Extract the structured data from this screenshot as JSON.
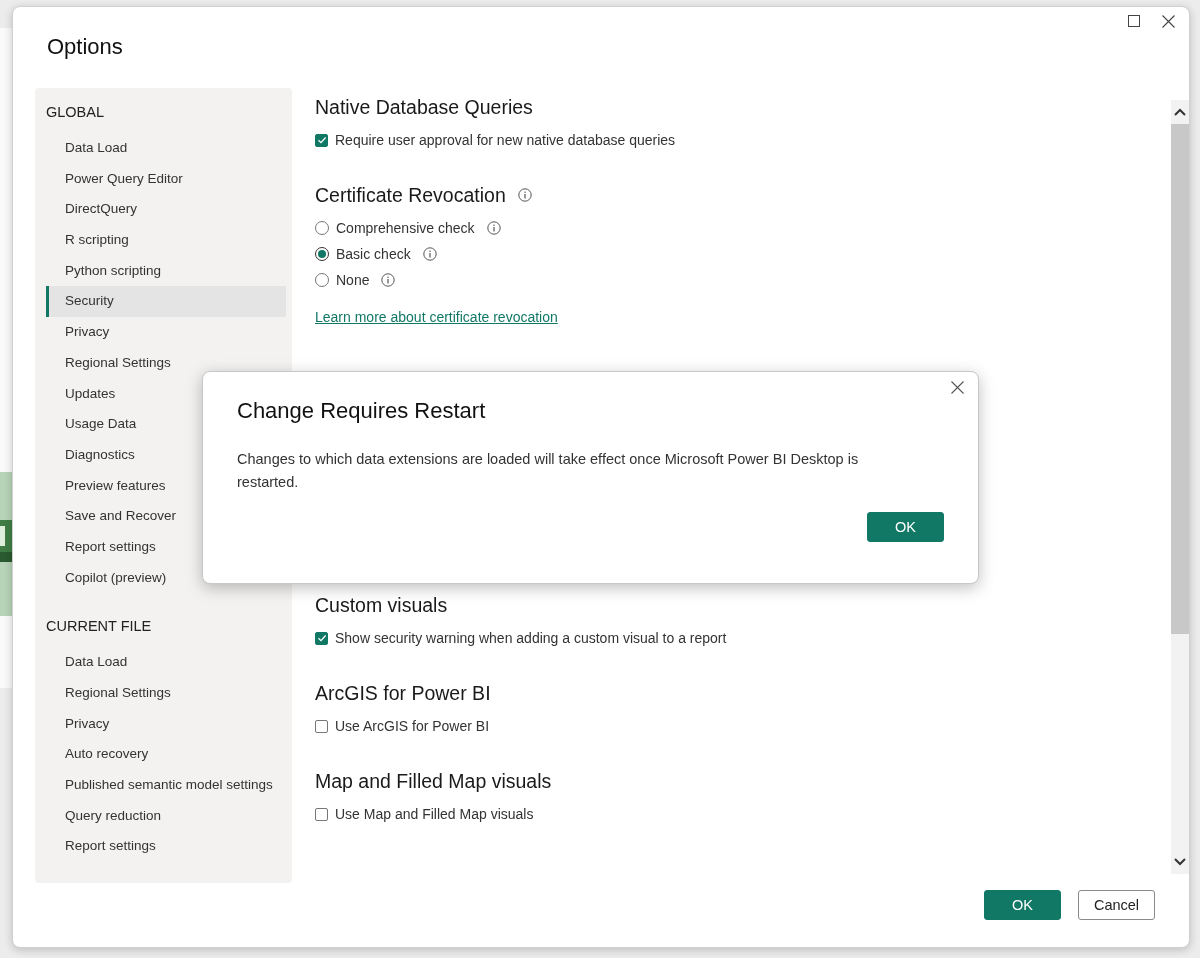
{
  "window": {
    "title": "Options"
  },
  "sidebar": {
    "groups": [
      {
        "title": "GLOBAL",
        "items": [
          {
            "label": "Data Load",
            "selected": false
          },
          {
            "label": "Power Query Editor",
            "selected": false
          },
          {
            "label": "DirectQuery",
            "selected": false
          },
          {
            "label": "R scripting",
            "selected": false
          },
          {
            "label": "Python scripting",
            "selected": false
          },
          {
            "label": "Security",
            "selected": true
          },
          {
            "label": "Privacy",
            "selected": false
          },
          {
            "label": "Regional Settings",
            "selected": false
          },
          {
            "label": "Updates",
            "selected": false
          },
          {
            "label": "Usage Data",
            "selected": false
          },
          {
            "label": "Diagnostics",
            "selected": false
          },
          {
            "label": "Preview features",
            "selected": false
          },
          {
            "label": "Save and Recover",
            "selected": false
          },
          {
            "label": "Report settings",
            "selected": false
          },
          {
            "label": "Copilot (preview)",
            "selected": false
          }
        ]
      },
      {
        "title": "CURRENT FILE",
        "items": [
          {
            "label": "Data Load",
            "selected": false
          },
          {
            "label": "Regional Settings",
            "selected": false
          },
          {
            "label": "Privacy",
            "selected": false
          },
          {
            "label": "Auto recovery",
            "selected": false
          },
          {
            "label": "Published semantic model settings",
            "selected": false
          },
          {
            "label": "Query reduction",
            "selected": false
          },
          {
            "label": "Report settings",
            "selected": false
          }
        ]
      }
    ]
  },
  "sections": [
    {
      "title": "Native Database Queries",
      "items": [
        {
          "kind": "checkbox",
          "label": "Require user approval for new native database queries",
          "checked": true
        }
      ]
    },
    {
      "title": "Certificate Revocation",
      "info": true,
      "items": [
        {
          "kind": "radio",
          "label": "Comprehensive check",
          "selected": false,
          "info": true
        },
        {
          "kind": "radio",
          "label": "Basic check",
          "selected": true,
          "info": true
        },
        {
          "kind": "radio",
          "label": "None",
          "selected": false,
          "info": true
        },
        {
          "kind": "link",
          "label": "Learn more about certificate revocation"
        }
      ]
    },
    {
      "title": "Custom visuals",
      "items": [
        {
          "kind": "checkbox",
          "label": "Show security warning when adding a custom visual to a report",
          "checked": true
        }
      ]
    },
    {
      "title": "ArcGIS for Power BI",
      "items": [
        {
          "kind": "checkbox",
          "label": "Use ArcGIS for Power BI",
          "checked": false
        }
      ]
    },
    {
      "title": "Map and Filled Map visuals",
      "items": [
        {
          "kind": "checkbox",
          "label": "Use Map and Filled Map visuals",
          "checked": false
        }
      ]
    }
  ],
  "footer": {
    "buttons": [
      {
        "label": "OK",
        "kind": "primary"
      },
      {
        "label": "Cancel",
        "kind": "secondary"
      }
    ]
  },
  "dialog": {
    "title": "Change Requires Restart",
    "message": "Changes to which data extensions are loaded will take effect once Microsoft Power BI Desktop is restarted.",
    "button": "OK"
  }
}
